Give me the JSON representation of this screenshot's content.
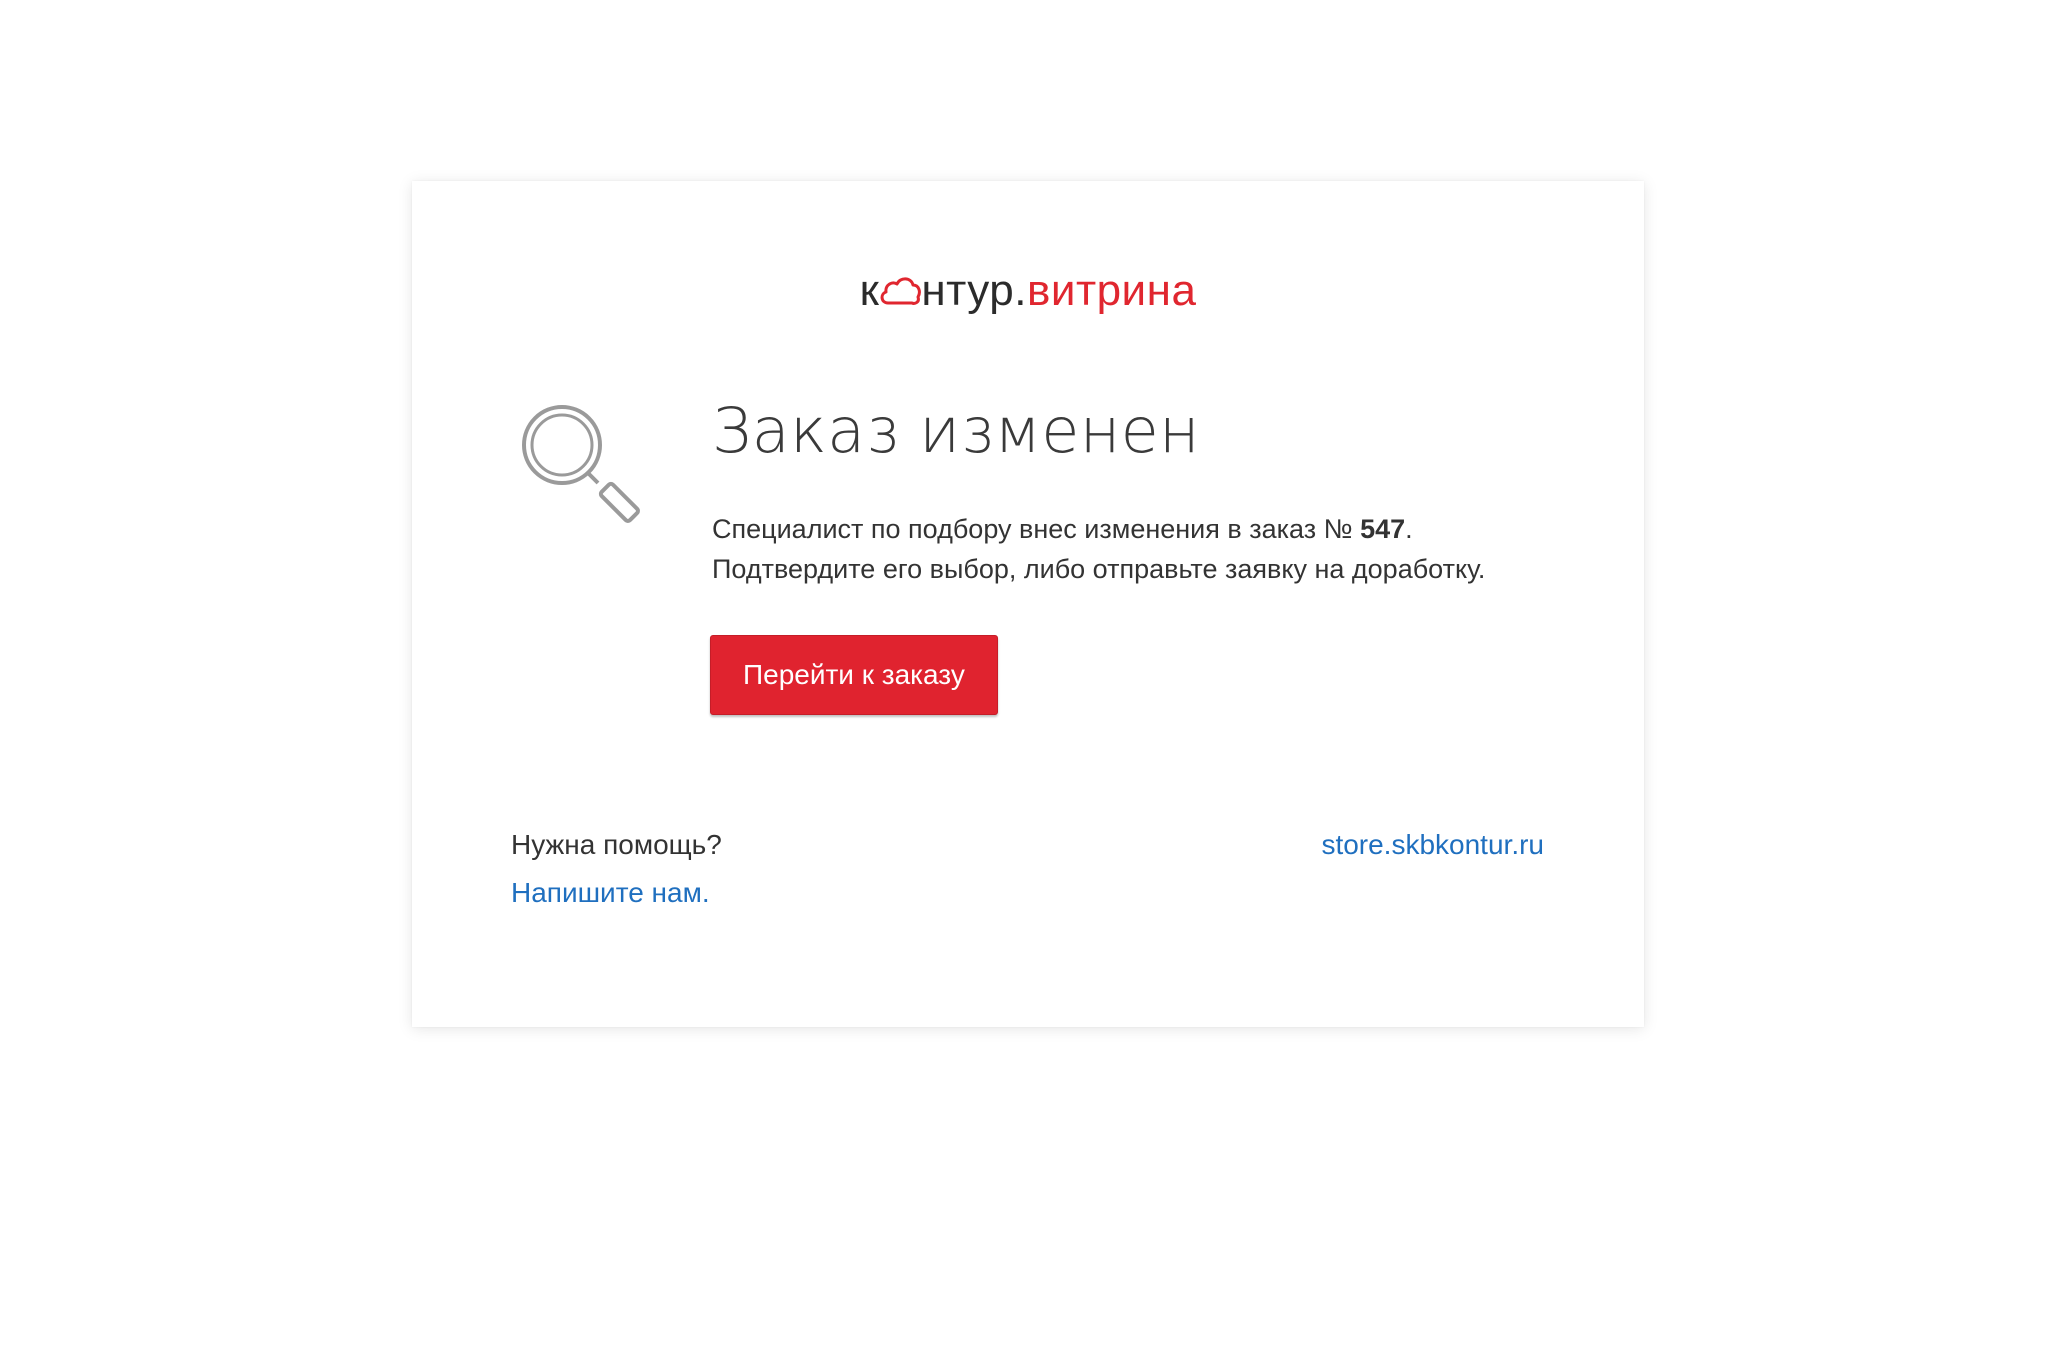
{
  "logo": {
    "part1": "к",
    "part2": "нтур.",
    "part3": "витрина",
    "dark_color": "#2b2b2b",
    "red_color": "#e0262f"
  },
  "illustration": {
    "icon": "magnifier-icon"
  },
  "main": {
    "title": "Заказ изменен",
    "message_line1_prefix": "Специалист по подбору внес изменения в заказ № ",
    "order_number": "547",
    "message_line1_suffix": ".",
    "message_line2": "Подтвердите его выбор, либо отправьте заявку на доработку.",
    "cta_label": "Перейти к заказу",
    "cta_color": "#e0232f"
  },
  "footer": {
    "help_text": "Нужна помощь?",
    "contact_link": "Напишите нам.",
    "site_link": "store.skbkontur.ru",
    "link_color": "#1f6fbf"
  }
}
